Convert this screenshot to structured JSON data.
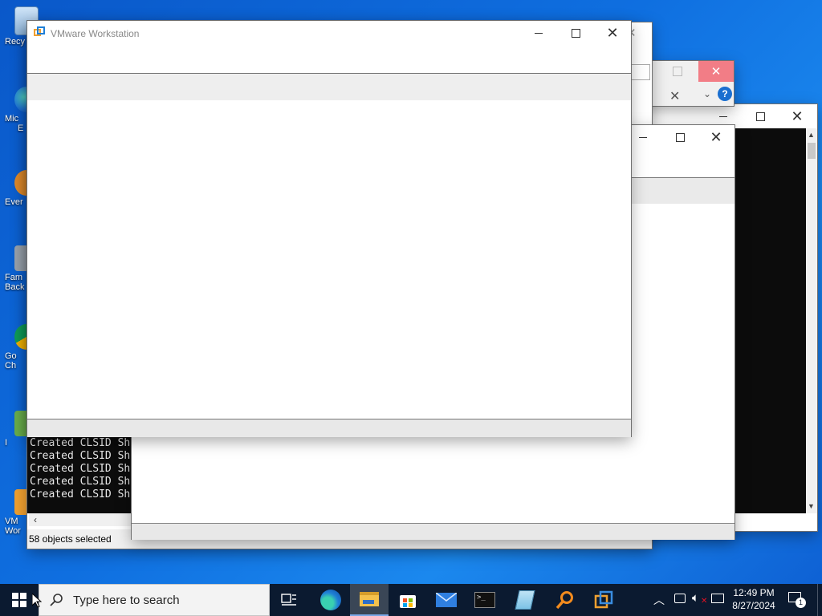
{
  "desktop_icons": [
    {
      "label": "Recy",
      "icon": "recycle-bin-icon"
    },
    {
      "label": "Mic",
      "label2": "E",
      "icon": "edge-icon"
    },
    {
      "label": "Ever",
      "icon": "everything-icon"
    },
    {
      "label": "Fam",
      "label2": "Back",
      "icon": "backup-icon"
    },
    {
      "label": "Go",
      "label2": "Ch",
      "icon": "chrome-icon"
    },
    {
      "label": "I",
      "icon": "shortcut-icon"
    },
    {
      "label": "VM",
      "label2": "Wor",
      "icon": "vmware-icon"
    }
  ],
  "main_window": {
    "title": "VMware Workstation"
  },
  "console": {
    "lines": [
      "Created CLSID Sh",
      "Created CLSID Sh",
      "Created CLSID Sh",
      "Created CLSID Sh",
      "Created CLSID Sh"
    ]
  },
  "explorer_status": "58 objects selected",
  "search": {
    "placeholder": "Type here to search"
  },
  "taskbar_apps": [
    {
      "name": "task-view-icon",
      "active": false
    },
    {
      "name": "edge-icon",
      "active": false
    },
    {
      "name": "file-explorer-icon",
      "active": true
    },
    {
      "name": "store-icon",
      "active": false
    },
    {
      "name": "mail-icon",
      "active": false
    },
    {
      "name": "terminal-icon",
      "active": false
    },
    {
      "name": "notepad-icon",
      "active": false
    },
    {
      "name": "search-tool-icon",
      "active": false
    },
    {
      "name": "vmware-icon",
      "active": false
    }
  ],
  "clock": {
    "time": "12:49 PM",
    "date": "8/27/2024"
  },
  "notifications": {
    "count": "1"
  },
  "colors": {
    "desktop": "#0f6fe0",
    "taskbar": "#0b1a30",
    "close_red": "#e81123",
    "help_blue": "#1a6fd0",
    "console_bg": "#0c0c0c"
  }
}
